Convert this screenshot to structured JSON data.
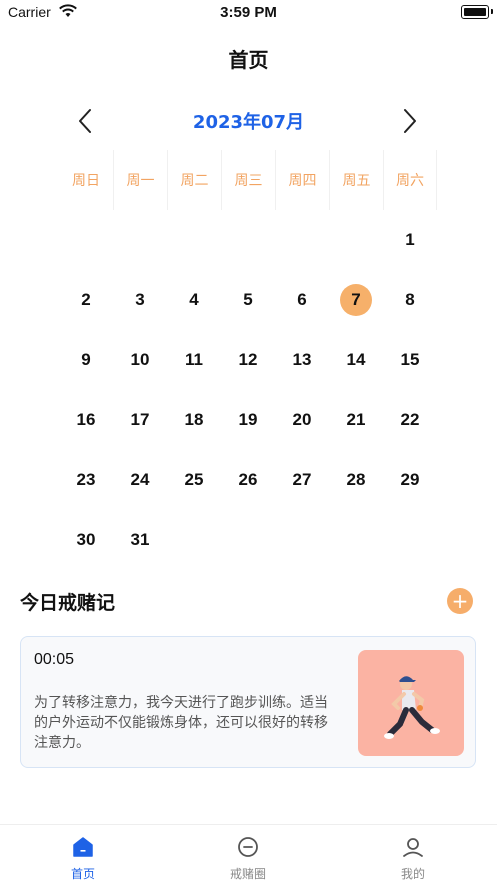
{
  "status_bar": {
    "carrier": "Carrier",
    "time": "3:59 PM"
  },
  "page": {
    "title": "首页"
  },
  "calendar": {
    "month_label": "2023年07月",
    "weekdays": [
      "周日",
      "周一",
      "周二",
      "周三",
      "周四",
      "周五",
      "周六"
    ],
    "leading_blanks": 6,
    "days": [
      "1",
      "2",
      "3",
      "4",
      "5",
      "6",
      "7",
      "8",
      "9",
      "10",
      "11",
      "12",
      "13",
      "14",
      "15",
      "16",
      "17",
      "18",
      "19",
      "20",
      "21",
      "22",
      "23",
      "24",
      "25",
      "26",
      "27",
      "28",
      "29",
      "30",
      "31"
    ],
    "selected_day": "7",
    "highlight_color": "#f6b06a",
    "weekday_color": "#f2a462",
    "month_color": "#1e62e6"
  },
  "section": {
    "title": "今日戒赌记",
    "add_label": "+"
  },
  "record": {
    "time": "00:05",
    "text": "为了转移注意力，我今天进行了跑步训练。适当的户外运动不仅能锻炼身体，还可以很好的转移注意力。",
    "image_icon": "runner-illustration"
  },
  "tabs": [
    {
      "label": "首页",
      "icon": "home-icon",
      "active": true
    },
    {
      "label": "戒赌圈",
      "icon": "circle-minus-icon",
      "active": false
    },
    {
      "label": "我的",
      "icon": "user-icon",
      "active": false
    }
  ]
}
